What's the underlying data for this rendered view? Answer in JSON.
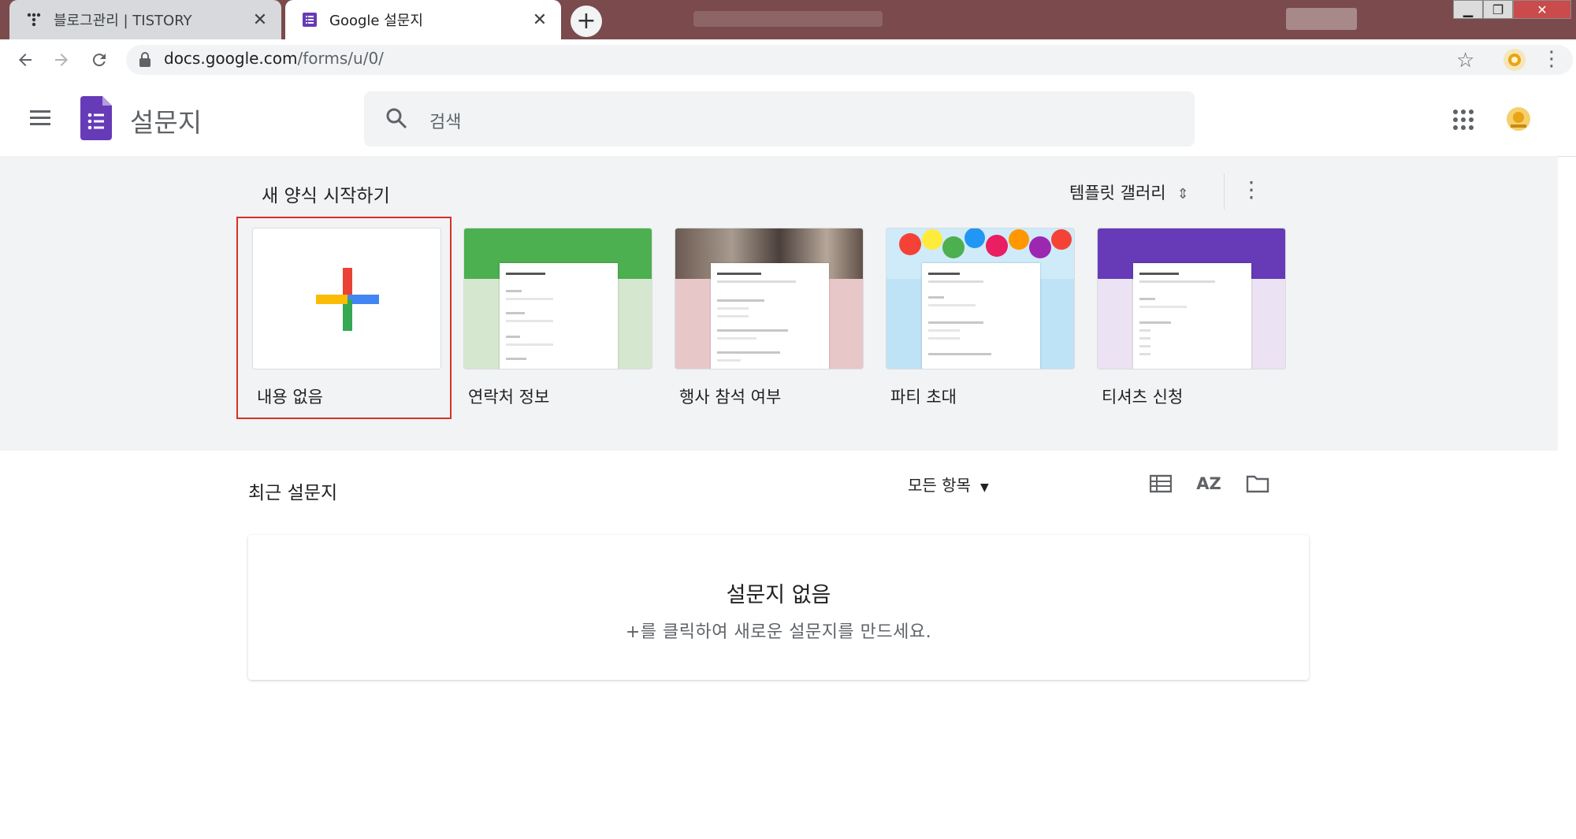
{
  "browser": {
    "tabs": [
      {
        "title": "블로그관리 | TISTORY",
        "active": false
      },
      {
        "title": "Google 설문지",
        "active": true
      }
    ],
    "new_tab_label": "+",
    "url_host": "docs.google.com",
    "url_path": "/forms/u/0/"
  },
  "app": {
    "title": "설문지",
    "search_placeholder": "검색"
  },
  "gallery": {
    "heading": "새 양식 시작하기",
    "template_gallery_label": "템플릿 갤러리",
    "templates": [
      {
        "label": "내용 없음"
      },
      {
        "label": "연락처 정보"
      },
      {
        "label": "행사 참석 여부"
      },
      {
        "label": "파티 초대"
      },
      {
        "label": "티셔츠 신청"
      }
    ]
  },
  "recent": {
    "heading": "최근 설문지",
    "owner_filter": "모든 항목",
    "empty_title": "설문지 없음",
    "empty_subtitle": "+를 클릭하여 새로운 설문지를 만드세요.",
    "sort_icon_label": "AZ"
  },
  "colors": {
    "forms_purple": "#673ab7",
    "selection_red": "#d93025"
  }
}
